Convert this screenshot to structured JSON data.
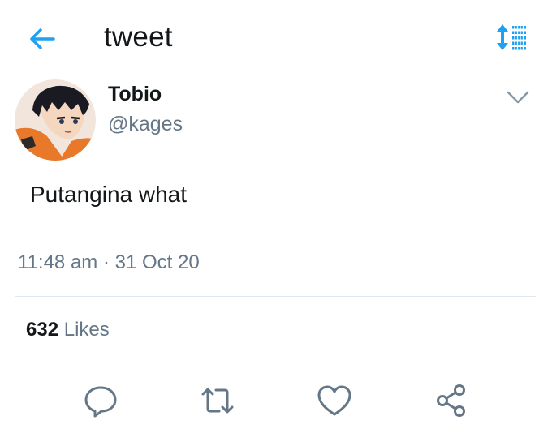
{
  "header": {
    "title": "tweet",
    "back_icon": "arrow-left-icon",
    "sort_icon": "sort-icon",
    "accent_color": "#1da1f2"
  },
  "author": {
    "display_name": "Tobio",
    "handle": "@kages",
    "avatar_icon": "avatar-illustration"
  },
  "tweet": {
    "text": "Putangina what",
    "time": "11:48 am",
    "separator": "·",
    "date": "31 Oct 20"
  },
  "stats": {
    "likes_count": "632",
    "likes_label": "Likes"
  },
  "actions": [
    {
      "icon": "reply-icon"
    },
    {
      "icon": "retweet-icon"
    },
    {
      "icon": "like-icon"
    },
    {
      "icon": "share-icon"
    }
  ],
  "colors": {
    "text_primary": "#14171a",
    "text_secondary": "#657786",
    "divider": "#e1e8ed",
    "accent": "#1da1f2"
  }
}
